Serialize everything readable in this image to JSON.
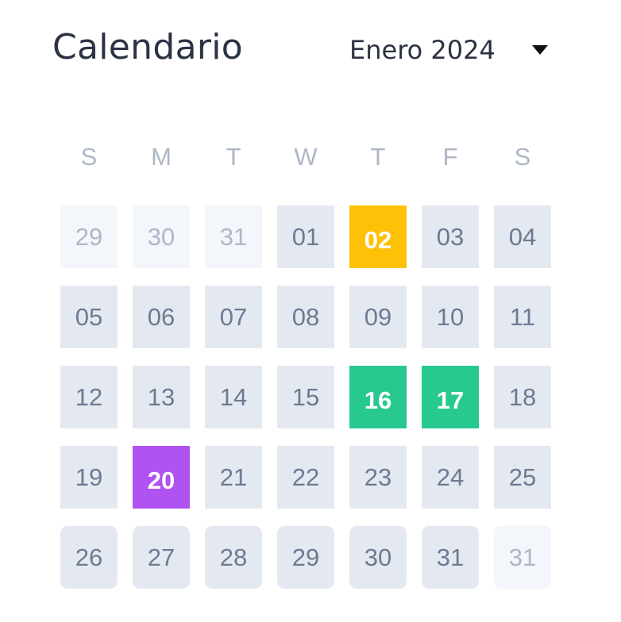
{
  "header": {
    "title": "Calendario",
    "month_label": "Enero 2024"
  },
  "weekdays": [
    "S",
    "M",
    "T",
    "W",
    "T",
    "F",
    "S"
  ],
  "weeks": [
    [
      {
        "label": "29",
        "state": "muted"
      },
      {
        "label": "30",
        "state": "muted"
      },
      {
        "label": "31",
        "state": "muted"
      },
      {
        "label": "01",
        "state": "normal"
      },
      {
        "label": "02",
        "state": "highlight",
        "color": "#ffc107"
      },
      {
        "label": "03",
        "state": "normal"
      },
      {
        "label": "04",
        "state": "normal"
      }
    ],
    [
      {
        "label": "05",
        "state": "normal"
      },
      {
        "label": "06",
        "state": "normal"
      },
      {
        "label": "07",
        "state": "normal"
      },
      {
        "label": "08",
        "state": "normal"
      },
      {
        "label": "09",
        "state": "normal"
      },
      {
        "label": "10",
        "state": "normal"
      },
      {
        "label": "11",
        "state": "normal"
      }
    ],
    [
      {
        "label": "12",
        "state": "normal"
      },
      {
        "label": "13",
        "state": "normal"
      },
      {
        "label": "14",
        "state": "normal"
      },
      {
        "label": "15",
        "state": "normal"
      },
      {
        "label": "16",
        "state": "highlight",
        "color": "#27c98f"
      },
      {
        "label": "17",
        "state": "highlight",
        "color": "#27c98f"
      },
      {
        "label": "18",
        "state": "normal"
      }
    ],
    [
      {
        "label": "19",
        "state": "normal"
      },
      {
        "label": "20",
        "state": "highlight",
        "color": "#b152f2"
      },
      {
        "label": "21",
        "state": "normal"
      },
      {
        "label": "22",
        "state": "normal"
      },
      {
        "label": "23",
        "state": "normal"
      },
      {
        "label": "24",
        "state": "normal"
      },
      {
        "label": "25",
        "state": "normal"
      }
    ],
    [
      {
        "label": "26",
        "state": "normal"
      },
      {
        "label": "27",
        "state": "normal"
      },
      {
        "label": "28",
        "state": "normal"
      },
      {
        "label": "29",
        "state": "normal"
      },
      {
        "label": "30",
        "state": "normal"
      },
      {
        "label": "31",
        "state": "normal"
      },
      {
        "label": "31",
        "state": "muted"
      }
    ]
  ],
  "icons": {
    "dropdown": "chevron-down-icon"
  }
}
